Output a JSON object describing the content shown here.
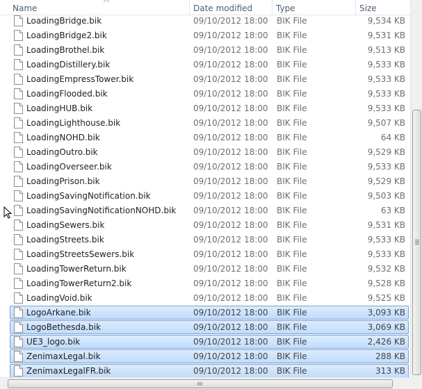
{
  "columns": {
    "name": "Name",
    "date_modified": "Date modified",
    "type": "Type",
    "size": "Size"
  },
  "files": [
    {
      "name": "LoadingBridge.bik",
      "date": "09/10/2012 18:00",
      "type": "BIK File",
      "size": "9,534 KB",
      "selected": false
    },
    {
      "name": "LoadingBridge2.bik",
      "date": "09/10/2012 18:00",
      "type": "BIK File",
      "size": "9,531 KB",
      "selected": false
    },
    {
      "name": "LoadingBrothel.bik",
      "date": "09/10/2012 18:00",
      "type": "BIK File",
      "size": "9,513 KB",
      "selected": false
    },
    {
      "name": "LoadingDistillery.bik",
      "date": "09/10/2012 18:00",
      "type": "BIK File",
      "size": "9,533 KB",
      "selected": false
    },
    {
      "name": "LoadingEmpressTower.bik",
      "date": "09/10/2012 18:00",
      "type": "BIK File",
      "size": "9,533 KB",
      "selected": false
    },
    {
      "name": "LoadingFlooded.bik",
      "date": "09/10/2012 18:00",
      "type": "BIK File",
      "size": "9,533 KB",
      "selected": false
    },
    {
      "name": "LoadingHUB.bik",
      "date": "09/10/2012 18:00",
      "type": "BIK File",
      "size": "9,533 KB",
      "selected": false
    },
    {
      "name": "LoadingLighthouse.bik",
      "date": "09/10/2012 18:00",
      "type": "BIK File",
      "size": "9,507 KB",
      "selected": false
    },
    {
      "name": "LoadingNOHD.bik",
      "date": "09/10/2012 18:00",
      "type": "BIK File",
      "size": "64 KB",
      "selected": false
    },
    {
      "name": "LoadingOutro.bik",
      "date": "09/10/2012 18:00",
      "type": "BIK File",
      "size": "9,529 KB",
      "selected": false
    },
    {
      "name": "LoadingOverseer.bik",
      "date": "09/10/2012 18:00",
      "type": "BIK File",
      "size": "9,533 KB",
      "selected": false
    },
    {
      "name": "LoadingPrison.bik",
      "date": "09/10/2012 18:00",
      "type": "BIK File",
      "size": "9,529 KB",
      "selected": false
    },
    {
      "name": "LoadingSavingNotification.bik",
      "date": "09/10/2012 18:00",
      "type": "BIK File",
      "size": "9,503 KB",
      "selected": false
    },
    {
      "name": "LoadingSavingNotificationNOHD.bik",
      "date": "09/10/2012 18:00",
      "type": "BIK File",
      "size": "63 KB",
      "selected": false
    },
    {
      "name": "LoadingSewers.bik",
      "date": "09/10/2012 18:00",
      "type": "BIK File",
      "size": "9,531 KB",
      "selected": false
    },
    {
      "name": "LoadingStreets.bik",
      "date": "09/10/2012 18:00",
      "type": "BIK File",
      "size": "9,533 KB",
      "selected": false
    },
    {
      "name": "LoadingStreetsSewers.bik",
      "date": "09/10/2012 18:00",
      "type": "BIK File",
      "size": "9,533 KB",
      "selected": false
    },
    {
      "name": "LoadingTowerReturn.bik",
      "date": "09/10/2012 18:00",
      "type": "BIK File",
      "size": "9,532 KB",
      "selected": false
    },
    {
      "name": "LoadingTowerReturn2.bik",
      "date": "09/10/2012 18:00",
      "type": "BIK File",
      "size": "9,528 KB",
      "selected": false
    },
    {
      "name": "LoadingVoid.bik",
      "date": "09/10/2012 18:00",
      "type": "BIK File",
      "size": "9,525 KB",
      "selected": false
    },
    {
      "name": "LogoArkane.bik",
      "date": "09/10/2012 18:00",
      "type": "BIK File",
      "size": "3,093 KB",
      "selected": true
    },
    {
      "name": "LogoBethesda.bik",
      "date": "09/10/2012 18:00",
      "type": "BIK File",
      "size": "3,069 KB",
      "selected": true
    },
    {
      "name": "UE3_logo.bik",
      "date": "09/10/2012 18:00",
      "type": "BIK File",
      "size": "2,426 KB",
      "selected": true
    },
    {
      "name": "ZenimaxLegal.bik",
      "date": "09/10/2012 18:00",
      "type": "BIK File",
      "size": "288 KB",
      "selected": true
    },
    {
      "name": "ZenimaxLegalFR.bik",
      "date": "09/10/2012 18:00",
      "type": "BIK File",
      "size": "313 KB",
      "selected": true
    }
  ],
  "icons": {
    "file": "file-icon",
    "sort": "sort-ascending-arrow-icon",
    "cursor": "mouse-pointer-icon"
  },
  "colors": {
    "selection_fill": "#cce4fc",
    "selection_border": "#7da2ce",
    "header_text": "#4c607a"
  }
}
